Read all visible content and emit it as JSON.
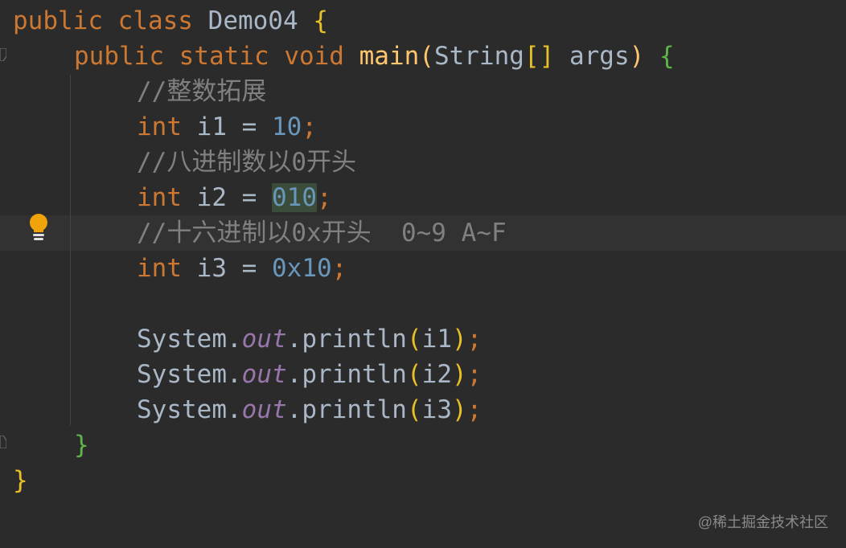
{
  "editor": {
    "lines": {
      "l1": {
        "kw1": "public",
        "kw2": "class",
        "name": "Demo04",
        "brace": "{"
      },
      "l2": {
        "kw1": "public",
        "kw2": "static",
        "kw3": "void",
        "fn": "main",
        "open": "(",
        "type": "String",
        "arr": "[]",
        "param": "args",
        "close": ")",
        "brace": "{"
      },
      "l3": {
        "comment": "//整数拓展"
      },
      "l4": {
        "type": "int",
        "name": "i1",
        "eq": "=",
        "num": "10",
        "semi": ";"
      },
      "l5": {
        "comment": "//八进制数以0开头"
      },
      "l6": {
        "type": "int",
        "name": "i2",
        "eq": "=",
        "num": "010",
        "semi": ";"
      },
      "l7": {
        "comment": "//十六进制以0x开头  0~9 A~F"
      },
      "l8": {
        "type": "int",
        "name": "i3",
        "eq": "=",
        "num": "0x10",
        "semi": ";"
      },
      "l10": {
        "cls": "System",
        "dot1": ".",
        "field": "out",
        "dot2": ".",
        "method": "println",
        "open": "(",
        "arg": "i1",
        "close": ")",
        "semi": ";"
      },
      "l11": {
        "cls": "System",
        "dot1": ".",
        "field": "out",
        "dot2": ".",
        "method": "println",
        "open": "(",
        "arg": "i2",
        "close": ")",
        "semi": ";"
      },
      "l12": {
        "cls": "System",
        "dot1": ".",
        "field": "out",
        "dot2": ".",
        "method": "println",
        "open": "(",
        "arg": "i3",
        "close": ")",
        "semi": ";"
      },
      "l13": {
        "brace": "}"
      },
      "l14": {
        "brace": "}"
      }
    },
    "gutter": {
      "bulb_icon": "lightbulb-icon",
      "fold_icon": "fold-marker-icon"
    }
  },
  "watermark": "@稀土掘金技术社区",
  "colors": {
    "background": "#2b2b2b",
    "keyword": "#cc7832",
    "number": "#6897bb",
    "comment": "#808080",
    "function": "#ffc66d",
    "field": "#9876aa",
    "bulb": "#f0a30a"
  }
}
